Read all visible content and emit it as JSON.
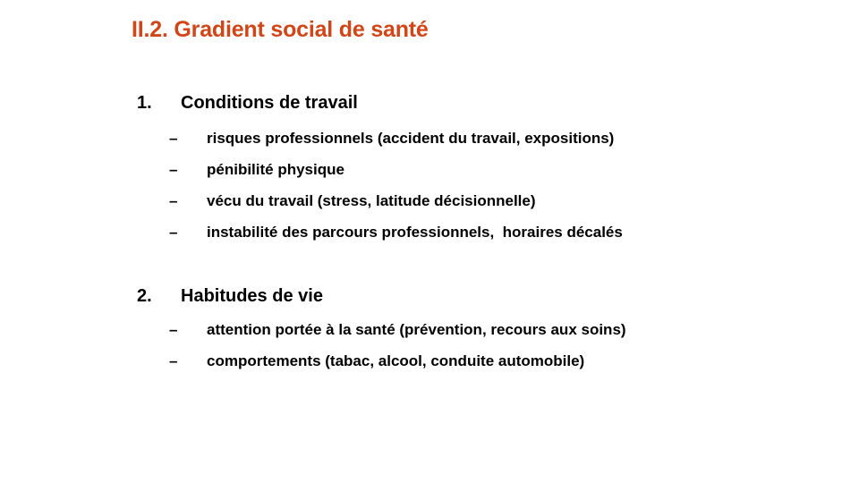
{
  "title": "II.2. Gradient social de santé",
  "sections": [
    {
      "number": "1.",
      "heading": "Conditions de travail",
      "items": [
        {
          "dash": "–",
          "text": "risques professionnels (accident du travail, expositions)"
        },
        {
          "dash": "–",
          "text": "pénibilité physique"
        },
        {
          "dash": "–",
          "text": "vécu du travail (stress, latitude décisionnelle)"
        },
        {
          "dash": "–",
          "text": "instabilité des parcours professionnels,  horaires décalés"
        }
      ]
    },
    {
      "number": "2.",
      "heading": "Habitudes de vie",
      "items": [
        {
          "dash": "–",
          "text": "attention portée à la santé (prévention, recours aux soins)"
        },
        {
          "dash": "–",
          "text": "comportements (tabac, alcool, conduite automobile)"
        }
      ]
    }
  ],
  "colors": {
    "title": "#d24516",
    "text": "#000000",
    "background": "#ffffff"
  }
}
